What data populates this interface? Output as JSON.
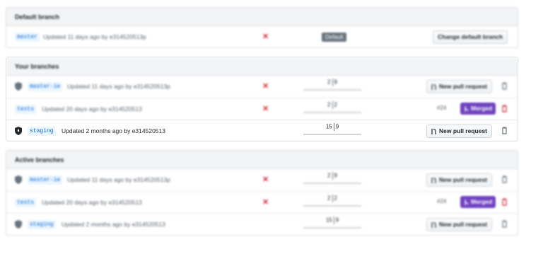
{
  "default_branch": {
    "header": "Default branch",
    "branch": {
      "name": "master",
      "updated": "Updated 11 days ago by e314520513p",
      "status": "failing",
      "badge": "Default",
      "action_label": "Change default branch"
    }
  },
  "your_branches": {
    "header": "Your branches",
    "rows": [
      {
        "name": "master-ie",
        "protected": true,
        "updated": "Updated 11 days ago by e314520513p",
        "status": "failing",
        "behind": "2",
        "ahead": "9",
        "action_label": "New pull request",
        "pr_number": "",
        "merged_label": ""
      },
      {
        "name": "tests",
        "protected": false,
        "updated": "Updated 20 days ago by e314520513",
        "status": "failing",
        "behind": "2",
        "ahead": "2",
        "action_label": "",
        "pr_number": "#24",
        "merged_label": "Merged"
      },
      {
        "name": "staging",
        "protected": true,
        "updated": "Updated 2 months ago by e314520513",
        "status": "none",
        "behind": "15",
        "ahead": "9",
        "action_label": "New pull request",
        "pr_number": "",
        "merged_label": ""
      }
    ]
  },
  "active_branches": {
    "header": "Active branches",
    "rows": [
      {
        "name": "master-ie",
        "protected": true,
        "updated": "Updated 11 days ago by e314520513p",
        "status": "failing",
        "behind": "2",
        "ahead": "9",
        "action_label": "New pull request",
        "pr_number": "",
        "merged_label": ""
      },
      {
        "name": "tests",
        "protected": false,
        "updated": "Updated 20 days ago by e314520513",
        "status": "failing",
        "behind": "2",
        "ahead": "2",
        "action_label": "",
        "pr_number": "#24",
        "merged_label": "Merged"
      },
      {
        "name": "staging",
        "protected": true,
        "updated": "Updated 2 months ago by e314520513",
        "status": "none",
        "behind": "15",
        "ahead": "9",
        "action_label": "New pull request",
        "pr_number": "",
        "merged_label": ""
      }
    ]
  },
  "icons": {
    "status_fail": "x-icon",
    "protected": "shield-icon",
    "delete": "trash-icon",
    "pull_request": "git-pull-request-icon",
    "merged": "git-merge-icon"
  },
  "colors": {
    "link": "#0366d6",
    "fail": "#cb2431",
    "merged": "#6f42c1",
    "header_bg": "#f3f4f6",
    "default_badge": "#6a737d"
  }
}
